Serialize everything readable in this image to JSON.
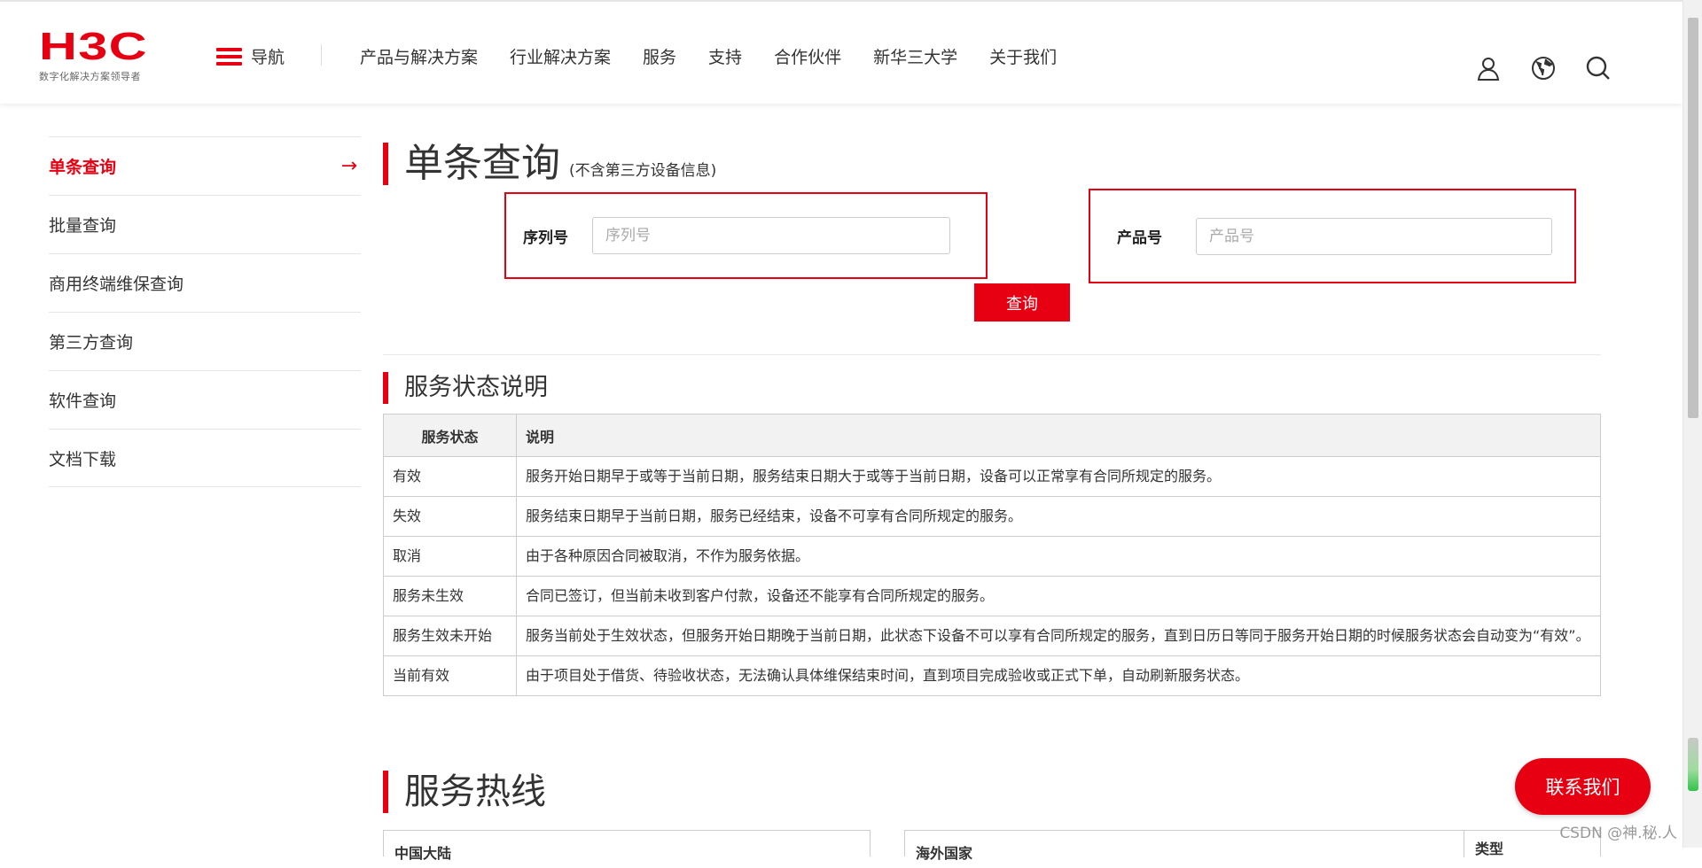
{
  "header": {
    "logo_mark": "H3C",
    "logo_sub": "数字化解决方案领导者",
    "nav_toggle_label": "导航",
    "menu": [
      "产品与解决方案",
      "行业解决方案",
      "服务",
      "支持",
      "合作伙伴",
      "新华三大学",
      "关于我们"
    ],
    "icons": [
      "user-icon",
      "globe-icon",
      "search-icon"
    ]
  },
  "sidebar": {
    "items": [
      {
        "label": "单条查询",
        "active": true
      },
      {
        "label": "批量查询"
      },
      {
        "label": "商用终端维保查询"
      },
      {
        "label": "第三方查询"
      },
      {
        "label": "软件查询"
      },
      {
        "label": "文档下载"
      }
    ],
    "active_arrow": "→"
  },
  "query": {
    "title": "单条查询",
    "subtitle": "(不含第三方设备信息)",
    "serial_label": "序列号",
    "serial_placeholder": "序列号",
    "product_label": "产品号",
    "product_placeholder": "产品号",
    "submit_label": "查询"
  },
  "status_section": {
    "title": "服务状态说明",
    "headers": [
      "服务状态",
      "说明"
    ],
    "rows": [
      [
        "有效",
        "服务开始日期早于或等于当前日期，服务结束日期大于或等于当前日期，设备可以正常享有合同所规定的服务。"
      ],
      [
        "失效",
        "服务结束日期早于当前日期，服务已经结束，设备不可享有合同所规定的服务。"
      ],
      [
        "取消",
        "由于各种原因合同被取消，不作为服务依据。"
      ],
      [
        "服务未生效",
        "合同已签订，但当前未收到客户付款，设备还不能享有合同所规定的服务。"
      ],
      [
        "服务生效未开始",
        "服务当前处于生效状态，但服务开始日期晚于当前日期，此状态下设备不可以享有合同所规定的服务，直到日历日等同于服务开始日期的时候服务状态会自动变为“有效”。"
      ],
      [
        "当前有效",
        "由于项目处于借货、待验收状态，无法确认具体维保结束时间，直到项目完成验收或正式下单，自动刷新服务状态。"
      ]
    ]
  },
  "hotline": {
    "title": "服务热线",
    "left_header": "中国大陆",
    "right_header": "海外国家",
    "right_header2": "类型"
  },
  "contact_button": "联系我们",
  "watermark": "CSDN @神.秘.人",
  "colors": {
    "brand": "#e60012"
  }
}
